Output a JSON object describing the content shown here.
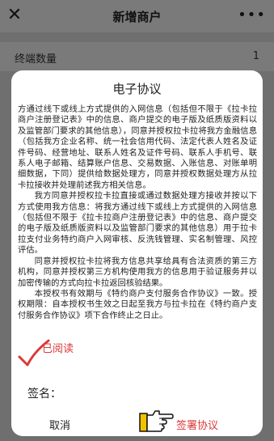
{
  "nav": {
    "close_icon": "close-icon",
    "title": "新增商户",
    "more_icon": "more-icon",
    "more_glyph": "•••"
  },
  "background": {
    "row_label": "终端数量",
    "row_value": "1"
  },
  "modal": {
    "title": "电子协议",
    "paragraphs": [
      "方通过线下或线上方式提供的入网信息（包括但不限于《拉卡拉商户注册登记表》中的信息、商户提交的电子版及纸质版资料以及监管部门要求的其他信息），同意并授权拉卡拉将我方金融信息（包括我方企业名称、统一社会信用代码、法定代表人姓名及证件号码、经营地址、联系人姓名及证件号码、联系人手机号、联系人电子邮箱、结算账户信息、交易数据、入账信息、对账单明细数据，下同）提供给数据处理方，同意并授权数据处理方从拉卡拉接收并处理前述我方相关信息。",
      "我方同意并授权拉卡拉直接或通过数据处理方接收并按以下方式使用我方信息：将我方通过线下或线上方式提供的入网信息（包括但不限于《拉卡拉商户注册登记表》中的信息、商户提交的电子版及纸质版资料以及监管部门要求的其他信息）用于拉卡拉支付业务特约商户入网审核、反洗钱管理、实名制管理、风控评估。",
      "同意并授权拉卡拉将我方信息共享给具有合法资质的第三方机构，同意并授权第三方机构使用我方的信息用于验证服务并以加密传输的方式向拉卡拉返回核验结果。",
      "本授权书有效期与《特约商户支付服务合作协议》一致。授权期限：自本授权书生效之日起至我方与拉卡拉在《特约商户支付服务合作协议》项下合作终止之日止。"
    ],
    "check_icon": "checkmark-icon",
    "read_label": "已阅读",
    "sign_label": "签名：",
    "cancel_label": "取消",
    "hand_icon": "pointing-hand-icon",
    "sign_button_label": "签署协议",
    "accent_color": "#d93a3a"
  }
}
